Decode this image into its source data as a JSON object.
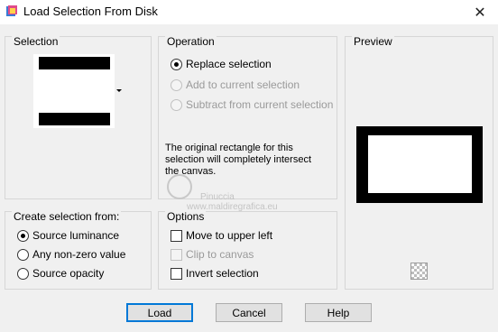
{
  "window": {
    "title": "Load Selection From Disk",
    "close_glyph": "✕"
  },
  "selection_group": {
    "label": "Selection"
  },
  "operation_group": {
    "label": "Operation",
    "options": [
      {
        "label": "Replace selection",
        "checked": true,
        "disabled": false
      },
      {
        "label": "Add to current selection",
        "checked": false,
        "disabled": true
      },
      {
        "label": "Subtract from current selection",
        "checked": false,
        "disabled": true
      }
    ],
    "info": "The original rectangle for this selection will completely intersect the canvas."
  },
  "preview_group": {
    "label": "Preview"
  },
  "create_group": {
    "label": "Create selection from:",
    "options": [
      {
        "label": "Source luminance",
        "checked": true
      },
      {
        "label": "Any non-zero value",
        "checked": false
      },
      {
        "label": "Source opacity",
        "checked": false
      }
    ]
  },
  "options_group": {
    "label": "Options",
    "checks": [
      {
        "label": "Move to upper left",
        "checked": false,
        "disabled": false
      },
      {
        "label": "Clip to canvas",
        "checked": false,
        "disabled": true
      },
      {
        "label": "Invert selection",
        "checked": false,
        "disabled": false
      }
    ]
  },
  "buttons": {
    "load": "Load",
    "cancel": "Cancel",
    "help": "Help"
  },
  "watermark": {
    "line1": "Pinuccia",
    "line2": "www.maldiregrafica.eu"
  },
  "colors": {
    "dialog_bg": "#f0f0f0",
    "border": "#d6d6d6",
    "default_button_accent": "#0078d7"
  }
}
